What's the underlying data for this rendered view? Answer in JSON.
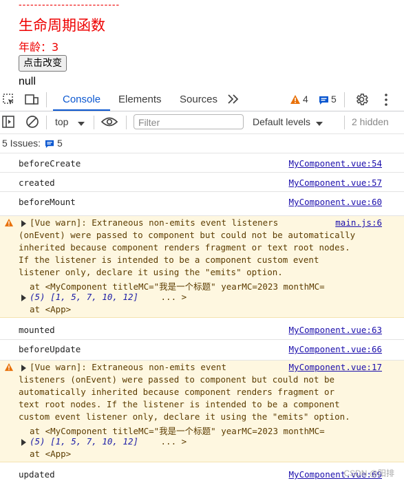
{
  "page": {
    "dashes": "--------------------------",
    "title": "生命周期函数",
    "age": "年龄：3",
    "button": "点击改变",
    "null_text": "null"
  },
  "devtools": {
    "tabs": [
      {
        "label": "Console",
        "active": true
      },
      {
        "label": "Elements",
        "active": false
      },
      {
        "label": "Sources",
        "active": false
      }
    ],
    "warning_count": "4",
    "message_count": "5",
    "context": "top",
    "filter_placeholder": "Filter",
    "levels": "Default levels",
    "hidden": "2 hidden",
    "issues_label": "5 Issues:",
    "issues_count": "5"
  },
  "logs": [
    {
      "msg": "beforeCreate",
      "src": "MyComponent.vue:54"
    },
    {
      "msg": "created",
      "src": "MyComponent.vue:57"
    },
    {
      "msg": "beforeMount",
      "src": "MyComponent.vue:60"
    },
    {
      "msg": "mounted",
      "src": "MyComponent.vue:63"
    },
    {
      "msg": "beforeUpdate",
      "src": "MyComponent.vue:66"
    },
    {
      "msg": "updated",
      "src": "MyComponent.vue:69"
    }
  ],
  "warn1": {
    "src": "main.js:6",
    "lines": [
      "[Vue warn]: Extraneous non-emits event listeners",
      "(onEvent) were passed to component but could not be automatically",
      "inherited because component renders fragment or text root nodes.",
      "If the listener is intended to be a component custom event",
      "listener only, declare it using the \"emits\" option."
    ],
    "at1": "at <MyComponent titleMC=\"我是一个标题\" yearMC=2023 monthMC=",
    "array": "(5) [1, 5, 7, 10, 12]",
    "ellipsis": " ... >",
    "at2": "at <App>"
  },
  "warn2": {
    "src": "MyComponent.vue:17",
    "lines": [
      "[Vue warn]: Extraneous non-emits event",
      "listeners (onEvent) were passed to component but could not be",
      "automatically inherited because component renders fragment or",
      "text root nodes. If the listener is intended to be a component",
      "custom event listener only, declare it using the \"emits\" option."
    ],
    "at1": "at <MyComponent titleMC=\"我是一个标题\" yearMC=2023 monthMC=",
    "array": "(5) [1, 5, 7, 10, 12]",
    "ellipsis": " ... >",
    "at2": "at <App>"
  },
  "watermark": "CSDN @阳排",
  "colors": {
    "accent": "#0b57d0",
    "warn_bg": "#fef7e0",
    "red": "#e00000",
    "link": "#1a0dab"
  }
}
